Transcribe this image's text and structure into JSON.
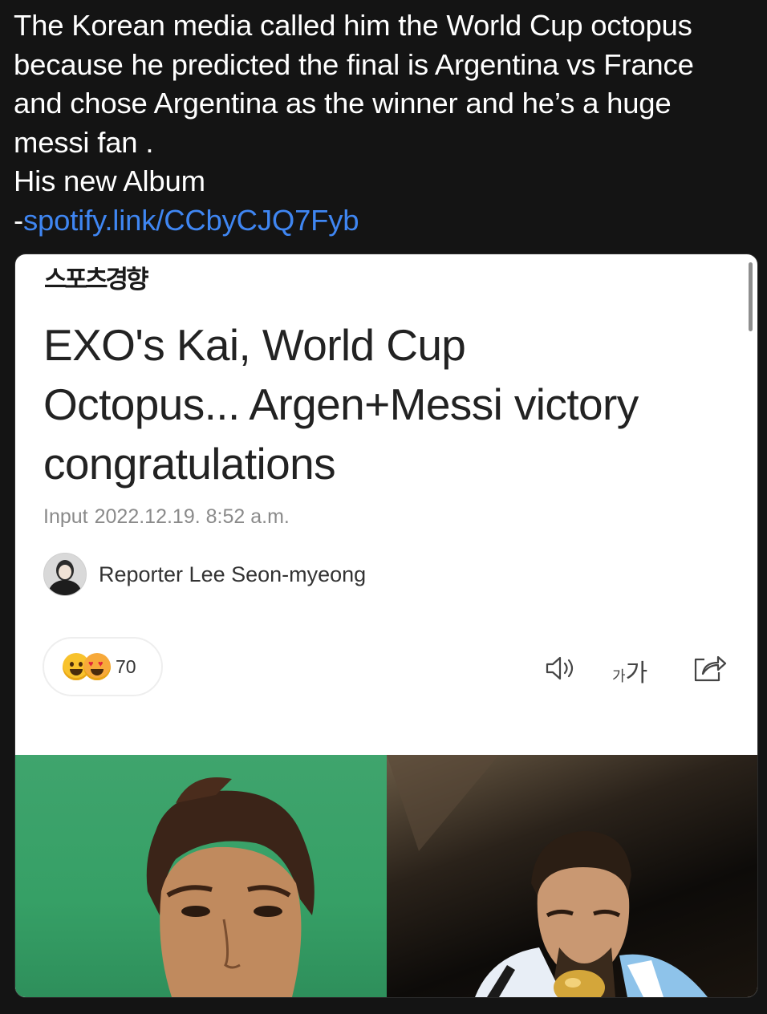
{
  "tweet": {
    "lines": [
      "The Korean media called him the World Cup octopus",
      "because he predicted the final is Argentina vs France",
      "and chose Argentina as the winner and he’s a huge",
      "messi fan .",
      "His new Album"
    ],
    "link_prefix": "-",
    "link_text": "spotify.link/CCbyCJQ7Fyb"
  },
  "article": {
    "brand": "스포츠경향",
    "headline_lines": [
      "EXO's Kai, World Cup",
      "Octopus... Argen+Messi victory",
      "congratulations"
    ],
    "input_label": "Input",
    "input_datetime": "2022.12.19. 8:52 a.m.",
    "reporter": "Reporter Lee Seon-myeong",
    "reaction_count": "70",
    "font_size_small": "가",
    "font_size_big": "가"
  },
  "icons": {
    "speaker": "speaker-icon",
    "font_size": "font-size-icon",
    "share": "share-icon"
  },
  "colors": {
    "background": "#141414",
    "link": "#3f86f2",
    "card": "#ffffff"
  }
}
